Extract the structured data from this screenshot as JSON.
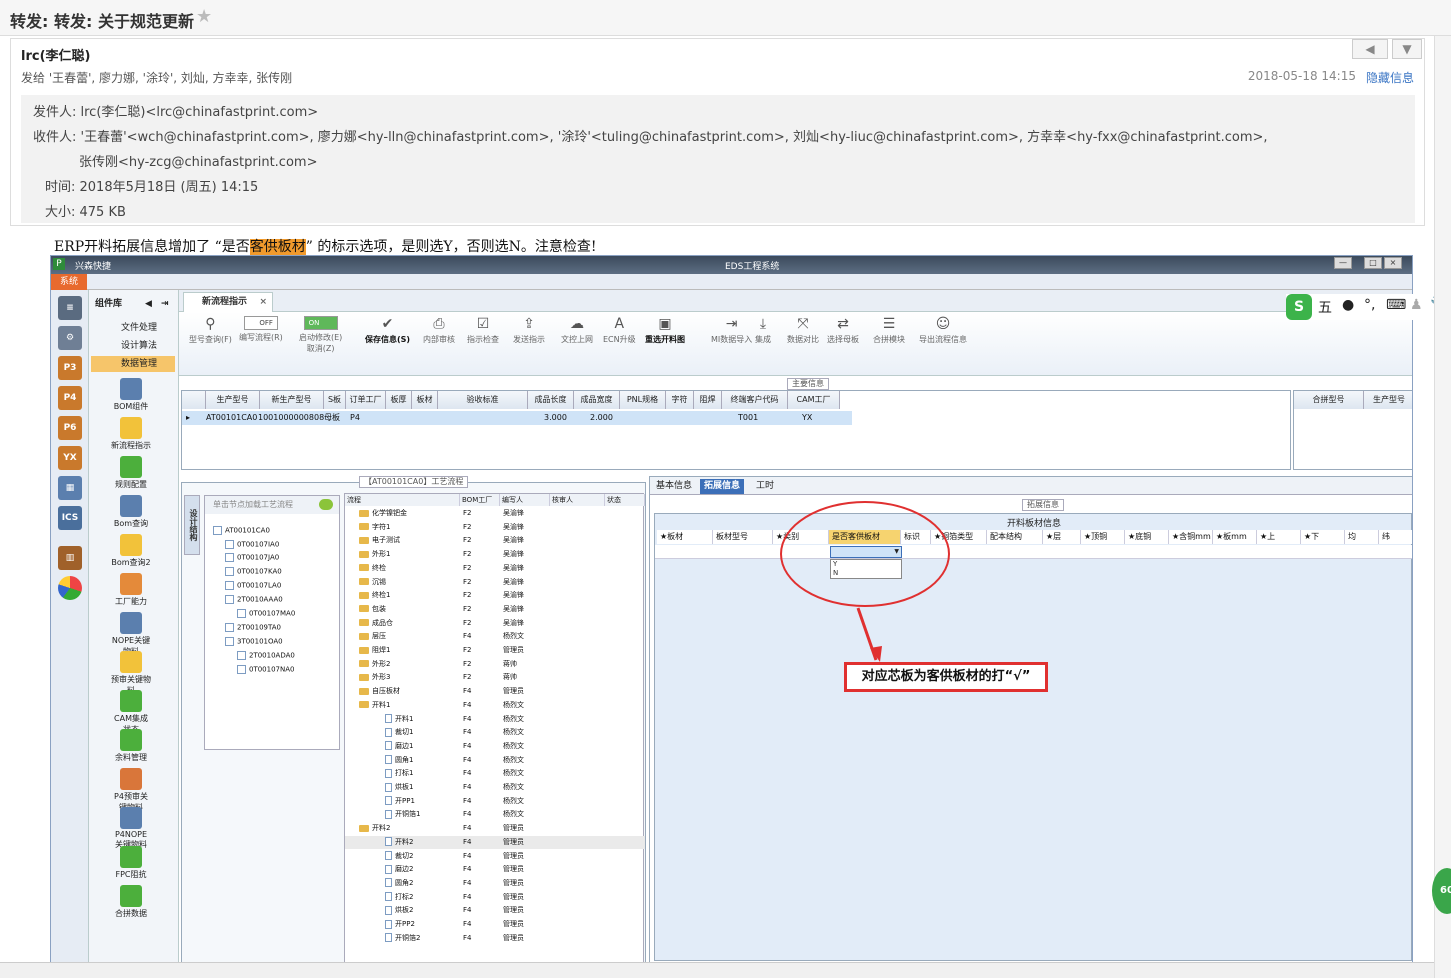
{
  "email": {
    "subject": "转发: 转发: 关于规范更新",
    "sender": "lrc(李仁聪)",
    "send_to": "发给 '王春蕾', 廖力娜, '涂玲', 刘灿, 方幸幸, 张传刚",
    "date": "2018-05-18 14:15",
    "hide_link": "隐藏信息",
    "headers": {
      "from": "发件人: lrc(李仁聪)<lrc@chinafastprint.com>",
      "to_line1": "收件人: '王春蕾'<wch@chinafastprint.com>, 廖力娜<hy-lln@chinafastprint.com>, '涂玲'<tuling@chinafastprint.com>, 刘灿<hy-liuc@chinafastprint.com>, 方幸幸<hy-fxx@chinafastprint.com>,",
      "to_line2": "张传刚<hy-zcg@chinafastprint.com>",
      "time": "时间: 2018年5月18日 (周五) 14:15",
      "size": "大小: 475 KB"
    },
    "body_pre": "ERP开料拓展信息增加了 “是否",
    "body_highlight": "客供板材",
    "body_post": "” 的标示选项，是则选Y，否则选N。注意检查!"
  },
  "app": {
    "company": "兴森快捷",
    "title": "EDS工程系统",
    "system_tab": "系统",
    "component_lib": "组件库",
    "left_icons": [
      "P3",
      "P4",
      "P6",
      "YX",
      "ICS"
    ],
    "menu_items": [
      "文件处理",
      "设计算法",
      "数据管理"
    ],
    "menu_icons": [
      "BOM组件",
      "新流程指示",
      "规则配置",
      "Bom查询",
      "Bom查询2",
      "工厂能力",
      "NOPE关键物料",
      "预审关键物料",
      "CAM集成状态",
      "余料管理",
      "P4预审关键物料",
      "P4NOPE关键物料",
      "FPC阻抗",
      "合拼数据"
    ],
    "doc_tab": "新流程指示",
    "toolbar": [
      {
        "label": "型号查询(F)",
        "icon": "search-icon"
      },
      {
        "label": "编写流程(R)",
        "toggle": "OFF"
      },
      {
        "label": "启动修改(E)\n取消(Z)",
        "toggle": "ON"
      },
      {
        "label": "保存信息(S)",
        "icon": "check-icon",
        "bold": true
      },
      {
        "label": "内部审核",
        "icon": "printer-icon"
      },
      {
        "label": "指示检查",
        "icon": "checkbox-icon"
      },
      {
        "label": "发送指示",
        "icon": "upload-icon"
      },
      {
        "label": "文控上网",
        "icon": "cloud-icon"
      },
      {
        "label": "ECN升级",
        "icon": "font-icon"
      },
      {
        "label": "重选开料图",
        "icon": "image-icon",
        "bold": true
      },
      {
        "label": "MI数据导入",
        "icon": "import-icon"
      },
      {
        "label": "集成",
        "icon": "download-icon"
      },
      {
        "label": "数据对比",
        "icon": "compare-icon"
      },
      {
        "label": "选择母板",
        "icon": "shuffle-icon"
      },
      {
        "label": "合拼模块",
        "icon": "list-icon"
      },
      {
        "label": "导出流程信息",
        "icon": "smile-icon"
      }
    ],
    "main_info_title": "主要信息",
    "grid_headers": [
      "生产型号",
      "新生产型号",
      "S板",
      "订单工厂",
      "板厚",
      "板材",
      "验收标准",
      "成品长度",
      "成品宽度",
      "PNL规格",
      "字符",
      "阻焊",
      "终端客户代码",
      "CAM工厂"
    ],
    "grid_row": {
      "model": "AT00101CA0",
      "new_model": "1001000000808",
      "s_board": "母板",
      "factory": "P4",
      "length": "3.000",
      "width": "2.000",
      "customer": "T001",
      "cam": "YX"
    },
    "right_grid_headers": [
      "合拼型号",
      "生产型号"
    ],
    "process_title": "【AT00101CA0】工艺流程",
    "vertical_tab": "设计结构",
    "tree_placeholder": "单击节点加载工艺流程",
    "tree_nodes": [
      "AT00101CA0",
      "0T00107IA0",
      "0T00107JA0",
      "0T00107KA0",
      "0T00107LA0",
      "2T0010AAA0",
      "0T00107MA0",
      "2T00109TA0",
      "3T00101OA0",
      "2T0010ADA0",
      "0T00107NA0"
    ],
    "flow_headers": [
      "流程",
      "BOM工厂",
      "编写人",
      "核审人",
      "状态"
    ],
    "flow_rows": [
      [
        "化学镍钯金",
        "F2",
        "吴渝锋"
      ],
      [
        "字符1",
        "F2",
        "吴渝锋"
      ],
      [
        "电子测试",
        "F2",
        "吴渝锋"
      ],
      [
        "外形1",
        "F2",
        "吴渝锋"
      ],
      [
        "终检",
        "F2",
        "吴渝锋"
      ],
      [
        "沉锡",
        "F2",
        "吴渝锋"
      ],
      [
        "终检1",
        "F2",
        "吴渝锋"
      ],
      [
        "包装",
        "F2",
        "吴渝锋"
      ],
      [
        "成品仓",
        "F2",
        "吴渝锋"
      ],
      [
        "层压",
        "F4",
        "杨烈文"
      ],
      [
        "阻焊1",
        "F2",
        "管理员"
      ],
      [
        "外形2",
        "F2",
        "蒋帅"
      ],
      [
        "外形3",
        "F2",
        "蒋帅"
      ],
      [
        "自压板材",
        "F4",
        "管理员"
      ],
      [
        "开料1",
        "F4",
        "杨烈文"
      ],
      [
        "开料1",
        "F4",
        "杨烈文"
      ],
      [
        "裁切1",
        "F4",
        "杨烈文"
      ],
      [
        "磨边1",
        "F4",
        "杨烈文"
      ],
      [
        "圆角1",
        "F4",
        "杨烈文"
      ],
      [
        "打标1",
        "F4",
        "杨烈文"
      ],
      [
        "烘板1",
        "F4",
        "杨烈文"
      ],
      [
        "开PP1",
        "F4",
        "杨烈文"
      ],
      [
        "开铜箔1",
        "F4",
        "杨烈文"
      ],
      [
        "开料2",
        "F4",
        "管理员"
      ],
      [
        "开料2",
        "F4",
        "管理员"
      ],
      [
        "裁切2",
        "F4",
        "管理员"
      ],
      [
        "磨边2",
        "F4",
        "管理员"
      ],
      [
        "圆角2",
        "F4",
        "管理员"
      ],
      [
        "打标2",
        "F4",
        "管理员"
      ],
      [
        "烘板2",
        "F4",
        "管理员"
      ],
      [
        "开PP2",
        "F4",
        "管理员"
      ],
      [
        "开铜箔2",
        "F4",
        "管理员"
      ]
    ],
    "right_tabs": [
      "基本信息",
      "拓展信息",
      "工时"
    ],
    "ext_title": "拓展信息",
    "ext_table_caption": "开料板材信息",
    "ext_headers": [
      "★板材",
      "板材型号",
      "★类别",
      "是否客供板材",
      "标识",
      "★铜箔类型",
      "配本结构",
      "★层",
      "★顶铜",
      "★底铜",
      "★含铜mm",
      "★板mm",
      "★上",
      "★下",
      "均",
      "纬"
    ],
    "dropdown_options": [
      "Y",
      "N"
    ]
  },
  "annotation": {
    "callout_text": "对应芯板为客供板材的打“√”"
  },
  "ime_toolbar": "五",
  "badge": "60",
  "colors": {
    "accent": "#3c6fb8",
    "highlight": "#f19a2c",
    "annotation": "#e03030",
    "system_tab": "#e86a2e"
  }
}
